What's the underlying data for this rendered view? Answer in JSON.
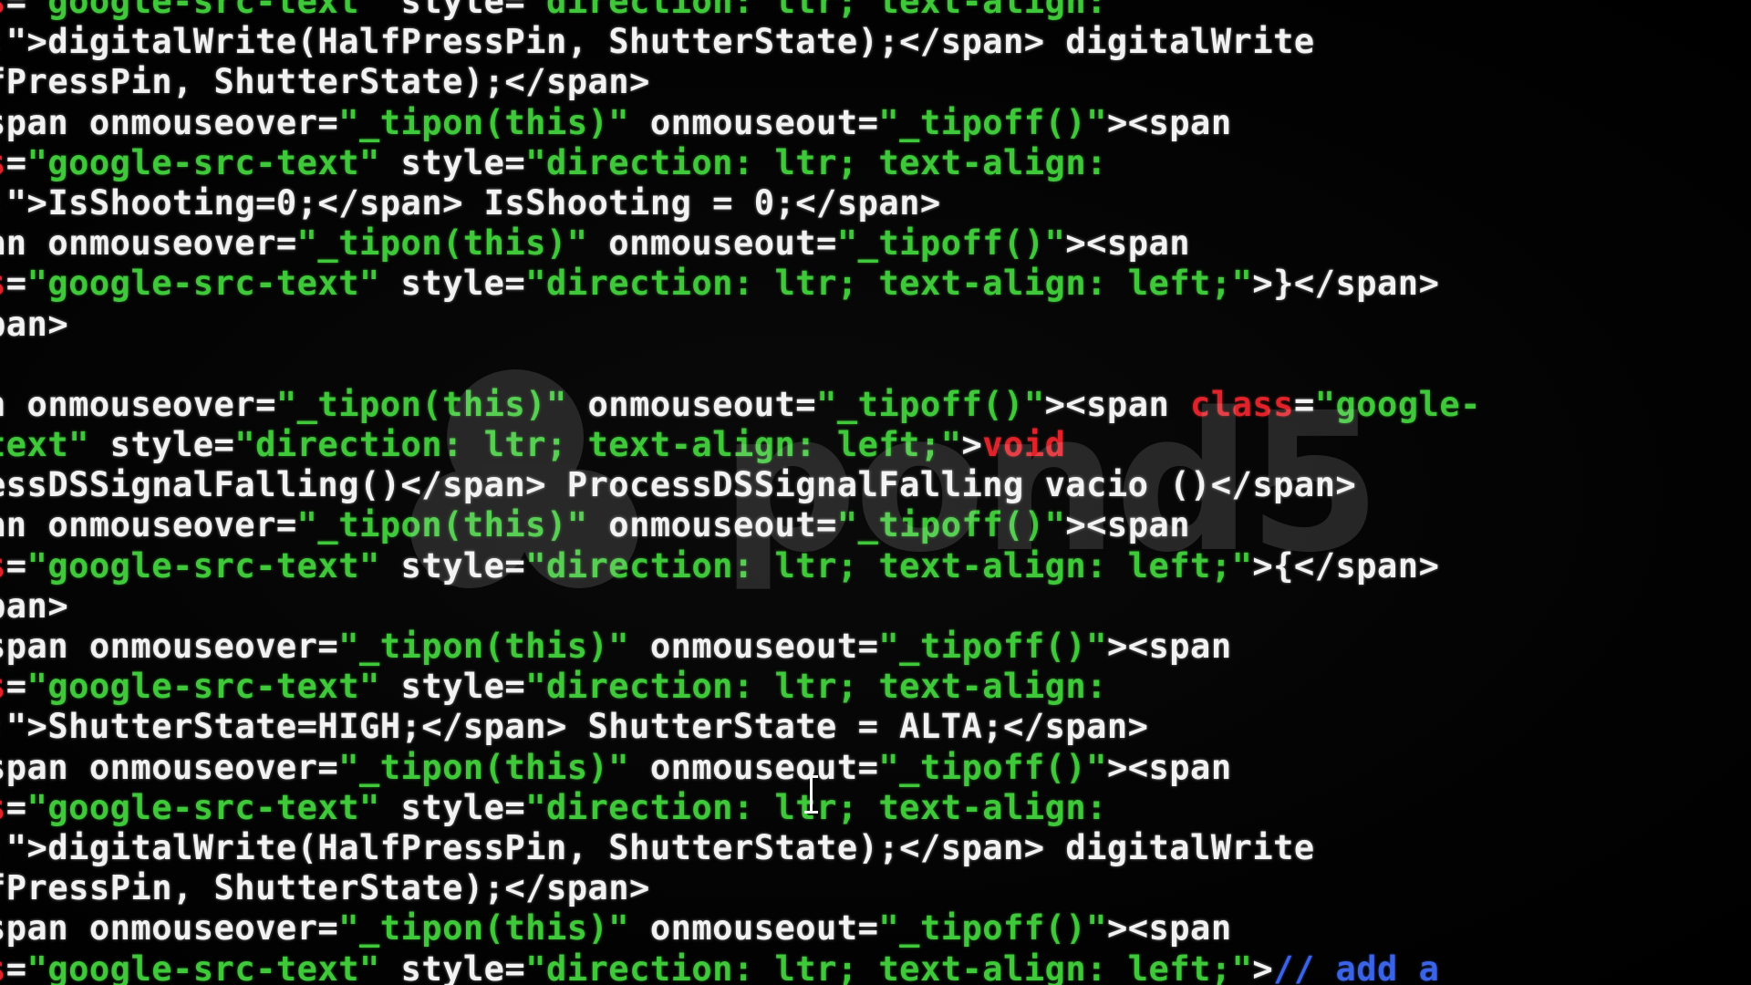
{
  "colors": {
    "background": "#000000",
    "text_white": "#f2f2f2",
    "text_green": "#3fc83a",
    "text_red": "#e0232b",
    "text_blue": "#3a63e6"
  },
  "code_lines": [
    [
      [
        "r",
        "s"
      ],
      [
        "w",
        "=\""
      ],
      [
        "g",
        "google-src-text\""
      ],
      [
        "w",
        " style="
      ],
      [
        "g",
        "\"direction: ltr; text-align:"
      ]
    ],
    [
      [
        "g",
        ";"
      ],
      [
        "w",
        "\">digitalWrite(HalfPressPin, ShutterState);</span> digitalWrite"
      ]
    ],
    [
      [
        "w",
        "fPressPin, ShutterState);</span>"
      ]
    ],
    [
      [
        "w",
        "span onmouseover="
      ],
      [
        "g",
        "\"_tipon(this)\""
      ],
      [
        "w",
        " onmouseout="
      ],
      [
        "g",
        "\"_tipoff()\""
      ],
      [
        "w",
        "><span"
      ]
    ],
    [
      [
        "r",
        "s"
      ],
      [
        "w",
        "="
      ],
      [
        "g",
        "\"google-src-text\""
      ],
      [
        "w",
        " style="
      ],
      [
        "g",
        "\"direction: ltr; text-align:"
      ]
    ],
    [
      [
        "g",
        ";"
      ],
      [
        "w",
        "\">IsShooting=0;</span> IsShooting = 0;</span>"
      ]
    ],
    [
      [
        "w",
        "an onmouseover="
      ],
      [
        "g",
        "\"_tipon(this)\""
      ],
      [
        "w",
        " onmouseout="
      ],
      [
        "g",
        "\"_tipoff()\""
      ],
      [
        "w",
        "><span"
      ]
    ],
    [
      [
        "r",
        "s"
      ],
      [
        "w",
        "="
      ],
      [
        "g",
        "\"google-src-text\""
      ],
      [
        "w",
        " style="
      ],
      [
        "g",
        "\"direction: ltr; text-align: left;\""
      ],
      [
        "w",
        ">}</span>"
      ]
    ],
    [
      [
        "w",
        "pan>"
      ]
    ],
    [
      [
        "w",
        ""
      ]
    ],
    [
      [
        "w",
        "n onmouseover="
      ],
      [
        "g",
        "\"_tipon(this)\""
      ],
      [
        "w",
        " onmouseout="
      ],
      [
        "g",
        "\"_tipoff()\""
      ],
      [
        "w",
        "><span "
      ],
      [
        "r",
        "class"
      ],
      [
        "w",
        "="
      ],
      [
        "g",
        "\"google-"
      ]
    ],
    [
      [
        "g",
        "text\""
      ],
      [
        "w",
        " style="
      ],
      [
        "g",
        "\"direction: ltr; text-align: left;\""
      ],
      [
        "w",
        ">"
      ],
      [
        "r",
        "void"
      ]
    ],
    [
      [
        "w",
        "essDSSignalFalling()</span> ProcessDSSignalFalling vacio ()</span>"
      ]
    ],
    [
      [
        "w",
        "an onmouseover="
      ],
      [
        "g",
        "\"_tipon(this)\""
      ],
      [
        "w",
        " onmouseout="
      ],
      [
        "g",
        "\"_tipoff()\""
      ],
      [
        "w",
        "><span"
      ]
    ],
    [
      [
        "r",
        "s"
      ],
      [
        "w",
        "="
      ],
      [
        "g",
        "\"google-src-text\""
      ],
      [
        "w",
        " style="
      ],
      [
        "g",
        "\"direction: ltr; text-align: left;\""
      ],
      [
        "w",
        ">{</span>"
      ]
    ],
    [
      [
        "w",
        "pan>"
      ]
    ],
    [
      [
        "w",
        "span onmouseover="
      ],
      [
        "g",
        "\"_tipon(this)\""
      ],
      [
        "w",
        " onmouseout="
      ],
      [
        "g",
        "\"_tipoff()\""
      ],
      [
        "w",
        "><span"
      ]
    ],
    [
      [
        "r",
        "s"
      ],
      [
        "w",
        "="
      ],
      [
        "g",
        "\"google-src-text\""
      ],
      [
        "w",
        " style="
      ],
      [
        "g",
        "\"direction: ltr; text-align:"
      ]
    ],
    [
      [
        "g",
        ";"
      ],
      [
        "w",
        "\">ShutterState=HIGH;</span> ShutterState = ALTA;</span>"
      ]
    ],
    [
      [
        "w",
        "span onmouseover="
      ],
      [
        "g",
        "\"_tipon(this)\""
      ],
      [
        "w",
        " onmouseout="
      ],
      [
        "g",
        "\"_tipoff()\""
      ],
      [
        "w",
        "><span"
      ]
    ],
    [
      [
        "r",
        "s"
      ],
      [
        "w",
        "="
      ],
      [
        "g",
        "\"google-src-text\""
      ],
      [
        "w",
        " style="
      ],
      [
        "g",
        "\"direction: ltr; text-align:"
      ]
    ],
    [
      [
        "g",
        ";"
      ],
      [
        "w",
        "\">digitalWrite(HalfPressPin, ShutterState);</span> digitalWrite"
      ]
    ],
    [
      [
        "w",
        "fPressPin, ShutterState);</span>"
      ]
    ],
    [
      [
        "w",
        "span onmouseover="
      ],
      [
        "g",
        "\"_tipon(this)\""
      ],
      [
        "w",
        " onmouseout="
      ],
      [
        "g",
        "\"_tipoff()\""
      ],
      [
        "w",
        "><span"
      ]
    ],
    [
      [
        "r",
        "s"
      ],
      [
        "w",
        "="
      ],
      [
        "g",
        "\"google-src-text\""
      ],
      [
        "w",
        " style="
      ],
      [
        "g",
        "\"direction: ltr; text-align: left;\""
      ],
      [
        "w",
        ">"
      ],
      [
        "b",
        "// add a"
      ]
    ]
  ],
  "watermark": {
    "text": "pond5",
    "icon": "pond5-logo-icon"
  },
  "cursor": {
    "icon": "text-cursor-icon"
  }
}
